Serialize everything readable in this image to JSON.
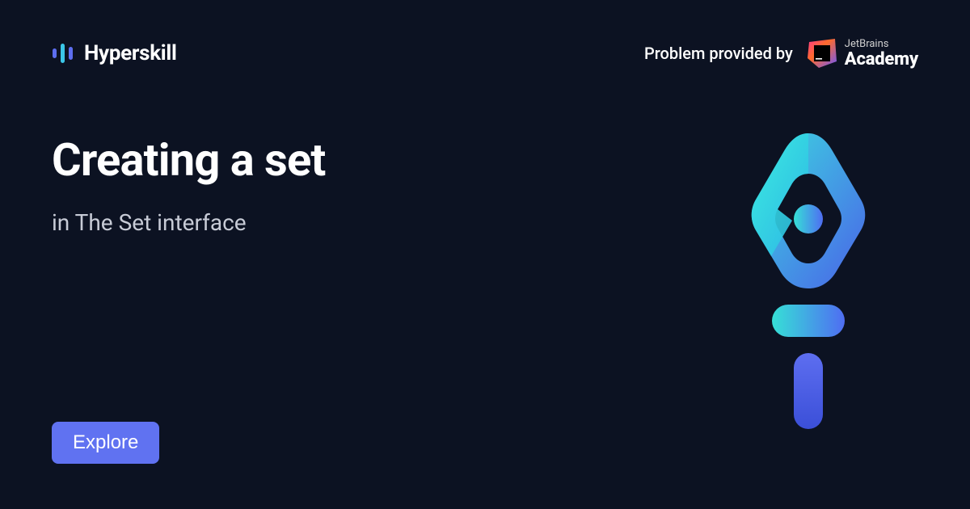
{
  "brand": {
    "name": "Hyperskill"
  },
  "provider": {
    "text": "Problem provided by",
    "brand_top": "JetBrains",
    "brand_bottom": "Academy"
  },
  "content": {
    "title": "Creating a set",
    "subtitle": "in The Set interface"
  },
  "cta": {
    "label": "Explore"
  }
}
